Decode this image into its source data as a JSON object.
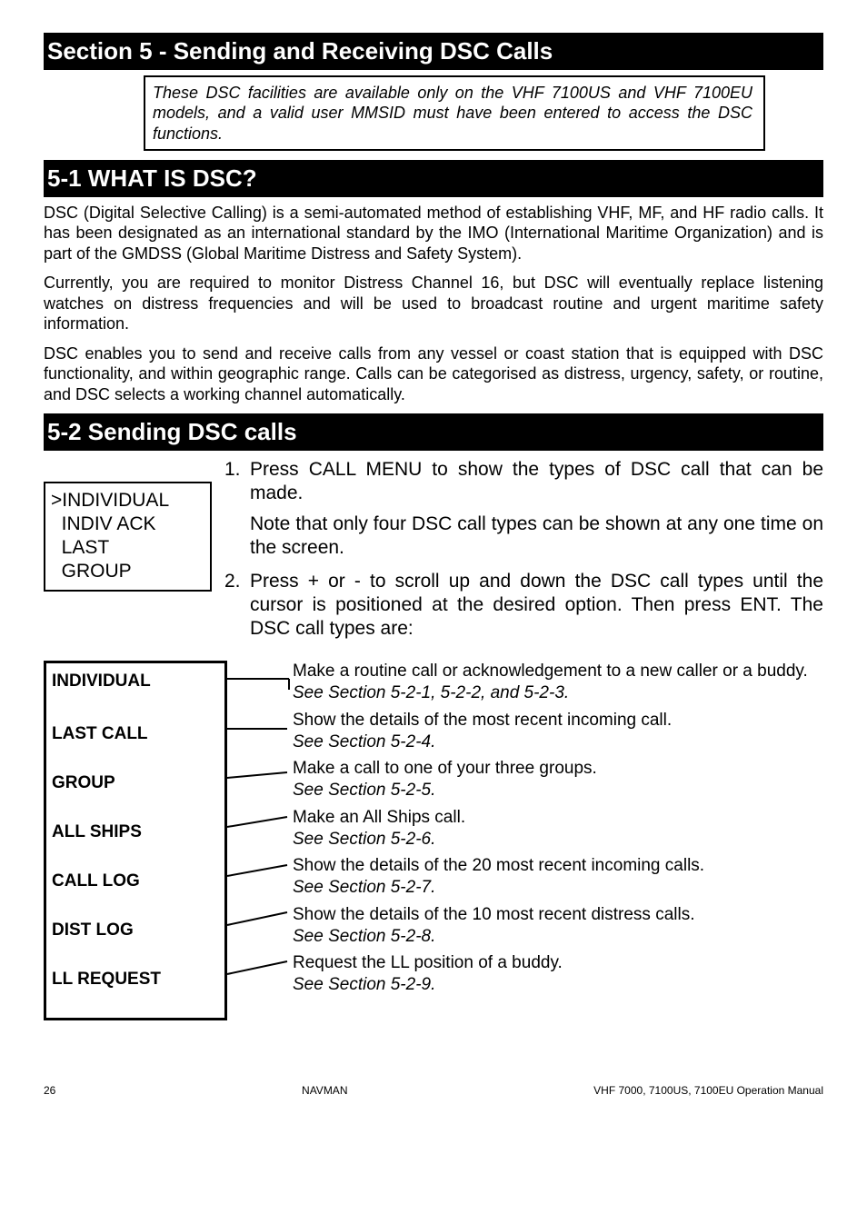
{
  "section_title": "Section 5 - Sending and Receiving DSC Calls",
  "note": "These DSC facilities are available only on the VHF 7100US and VHF 7100EU models, and a valid user MMSID must have been entered to access the DSC functions.",
  "h_5_1": "5-1 WHAT IS DSC?",
  "p1": "DSC (Digital Selective Calling) is a semi-automated method of establishing VHF, MF, and HF radio calls. It has been designated as an international standard by the IMO (International Maritime Organization) and is part of the GMDSS (Global Maritime Distress and Safety System).",
  "p2": "Currently, you are required to monitor Distress Channel 16, but DSC will eventually replace listening watches on distress frequencies and will be used to broadcast routine and urgent maritime safety information.",
  "p3": "DSC enables you to send and receive calls from any vessel or coast station that is equipped with DSC functionality, and within geographic range. Calls can be categorised as distress, urgency, safety, or routine, and DSC selects a working channel automatically.",
  "h_5_2": "5-2 Sending DSC calls",
  "menu": ">INDIVIDUAL\n  INDIV ACK\n  LAST\n  GROUP",
  "step1_num": "1.",
  "step1": "Press CALL MENU to show the types of DSC call that can be made.",
  "step1_note": "Note that only four DSC call types can be shown at any one time on the screen.",
  "step2_num": "2.",
  "step2": "Press + or - to scroll up and down the DSC call types until the cursor is positioned at the desired option. Then press ENT. The DSC call types are:",
  "types": {
    "l0": "INDIVIDUAL",
    "l1": "LAST CALL",
    "l2": "GROUP",
    "l3": "ALL SHIPS",
    "l4": "CALL LOG",
    "l5": "DIST LOG",
    "l6": "LL REQUEST"
  },
  "desc": {
    "d0a": "Make a routine call or acknowledgement to a new caller or a buddy. ",
    "d0b": "See Section 5-2-1, 5-2-2, and 5-2-3.",
    "d1a": "Show the details of the most recent incoming call.",
    "d1b": "See Section 5-2-4.",
    "d2a": "Make a call to one of your three groups.",
    "d2b": "See Section 5-2-5.",
    "d3a": "Make an All Ships call.",
    "d3b": "See Section 5-2-6.",
    "d4a": "Show the details of the 20 most recent incoming calls.",
    "d4b": "See Section 5-2-7.",
    "d5a": "Show the details of the 10 most recent distress calls.",
    "d5b": "See Section 5-2-8.",
    "d6a": "Request the LL position of a buddy.",
    "d6b": "See Section 5-2-9."
  },
  "footer": {
    "page": "26",
    "brand": "NAVMAN",
    "doc": "VHF 7000, 7100US, 7100EU Operation Manual"
  }
}
